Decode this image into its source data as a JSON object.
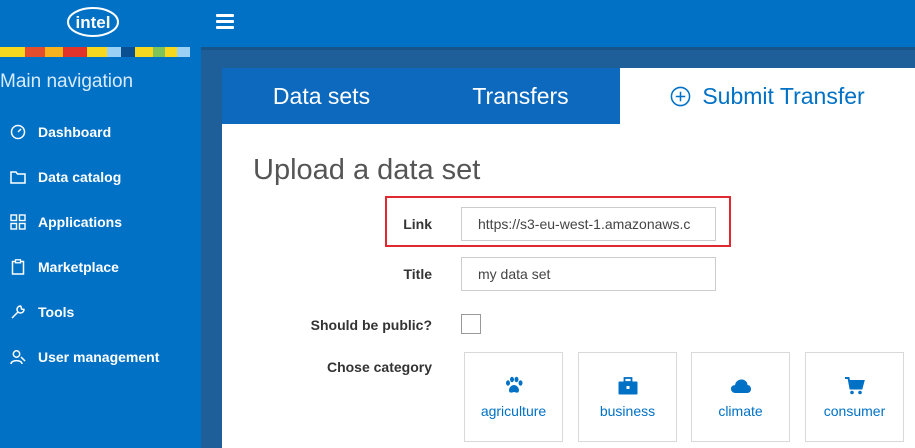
{
  "header": {
    "logo_text": "intel",
    "menu_icon": "hamburger-icon",
    "brand_color": "#0071c5"
  },
  "sidebar": {
    "title": "Main navigation",
    "items": [
      {
        "label": "Dashboard",
        "icon": "dashboard-icon"
      },
      {
        "label": "Data catalog",
        "icon": "folder-icon"
      },
      {
        "label": "Applications",
        "icon": "grid-icon"
      },
      {
        "label": "Marketplace",
        "icon": "clipboard-icon"
      },
      {
        "label": "Tools",
        "icon": "wrench-icon"
      },
      {
        "label": "User management",
        "icon": "users-icon"
      }
    ]
  },
  "tabs": [
    {
      "label": "Data sets",
      "active": false
    },
    {
      "label": "Transfers",
      "active": false
    },
    {
      "label": "Submit Transfer",
      "active": true,
      "icon": "plus-circle-icon"
    }
  ],
  "form": {
    "title": "Upload a data set",
    "link_label": "Link",
    "link_value": "https://s3-eu-west-1.amazonaws.c",
    "title_label": "Title",
    "title_value": "my data set",
    "public_label": "Should be public?",
    "public_checked": false,
    "category_label": "Chose category",
    "categories": [
      {
        "label": "agriculture",
        "icon": "paw-icon"
      },
      {
        "label": "business",
        "icon": "briefcase-icon"
      },
      {
        "label": "climate",
        "icon": "cloud-icon"
      },
      {
        "label": "consumer",
        "icon": "cart-icon"
      }
    ]
  }
}
